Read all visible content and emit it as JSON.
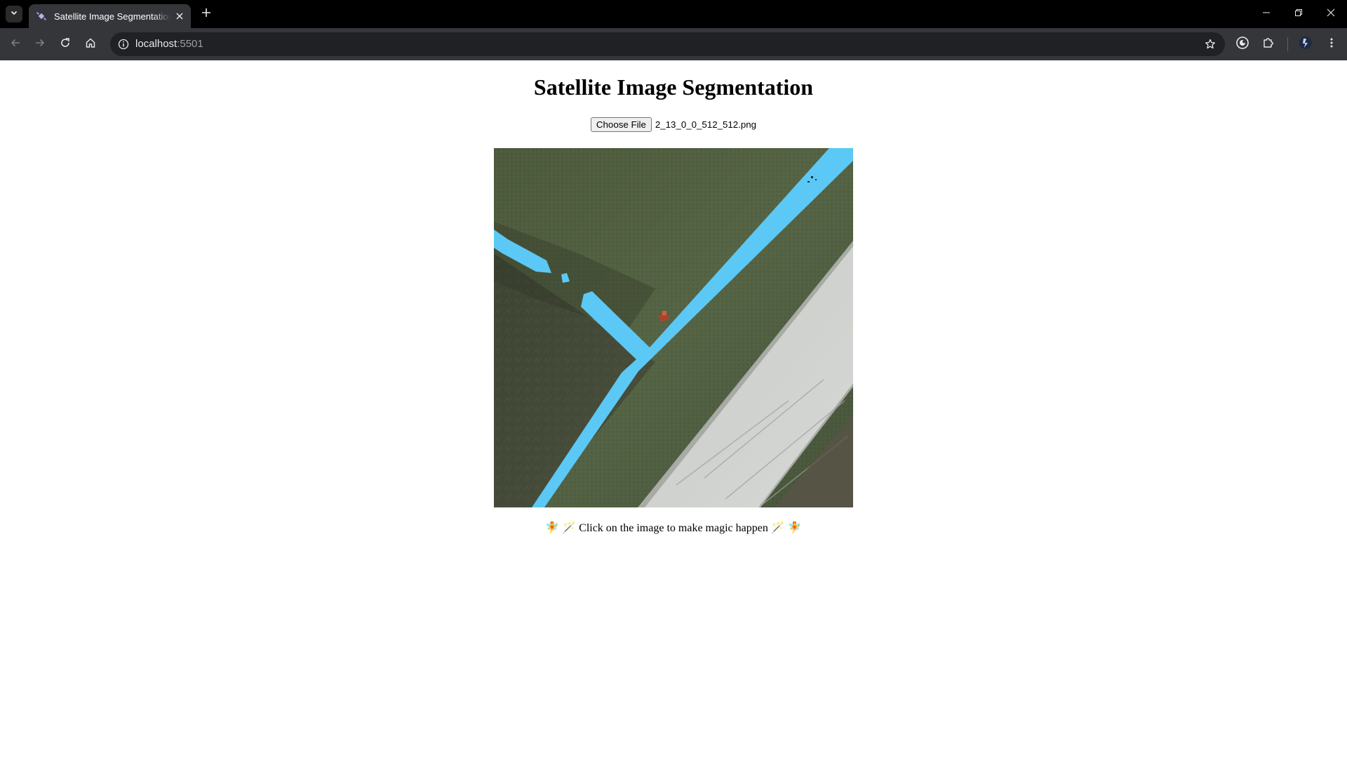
{
  "browser": {
    "tab_title": "Satellite Image Segmentation",
    "url_host": "localhost",
    "url_port": ":5501",
    "icons": {
      "tab_search": "chevron-down-icon",
      "favicon": "satellite-favicon-icon",
      "tab_close": "close-icon",
      "new_tab": "plus-icon",
      "back": "arrow-left-icon",
      "forward": "arrow-right-icon",
      "reload": "reload-icon",
      "home": "home-icon",
      "site_info": "info-icon",
      "bookmark": "star-icon",
      "extension_1": "extension-circle-icon",
      "extensions": "puzzle-icon",
      "profile": "profile-icon",
      "menu": "kebab-menu-icon",
      "minimize": "minimize-icon",
      "restore": "restore-icon",
      "close_window": "close-icon"
    }
  },
  "page": {
    "title": "Satellite Image Segmentation",
    "file_input": {
      "button_label": "Choose File",
      "file_name": "2_13_0_0_512_512.png"
    },
    "image": {
      "description_name": "satellite-image-with-segmentation-mask",
      "mask_color": "#5cc8f5"
    },
    "caption": "🧚 🪄 Click on the image to make magic happen 🪄 🧚"
  },
  "colors": {
    "tabbar_bg": "#000000",
    "toolbar_bg": "#35363a",
    "omnibox_bg": "#202124",
    "page_bg": "#ffffff"
  }
}
